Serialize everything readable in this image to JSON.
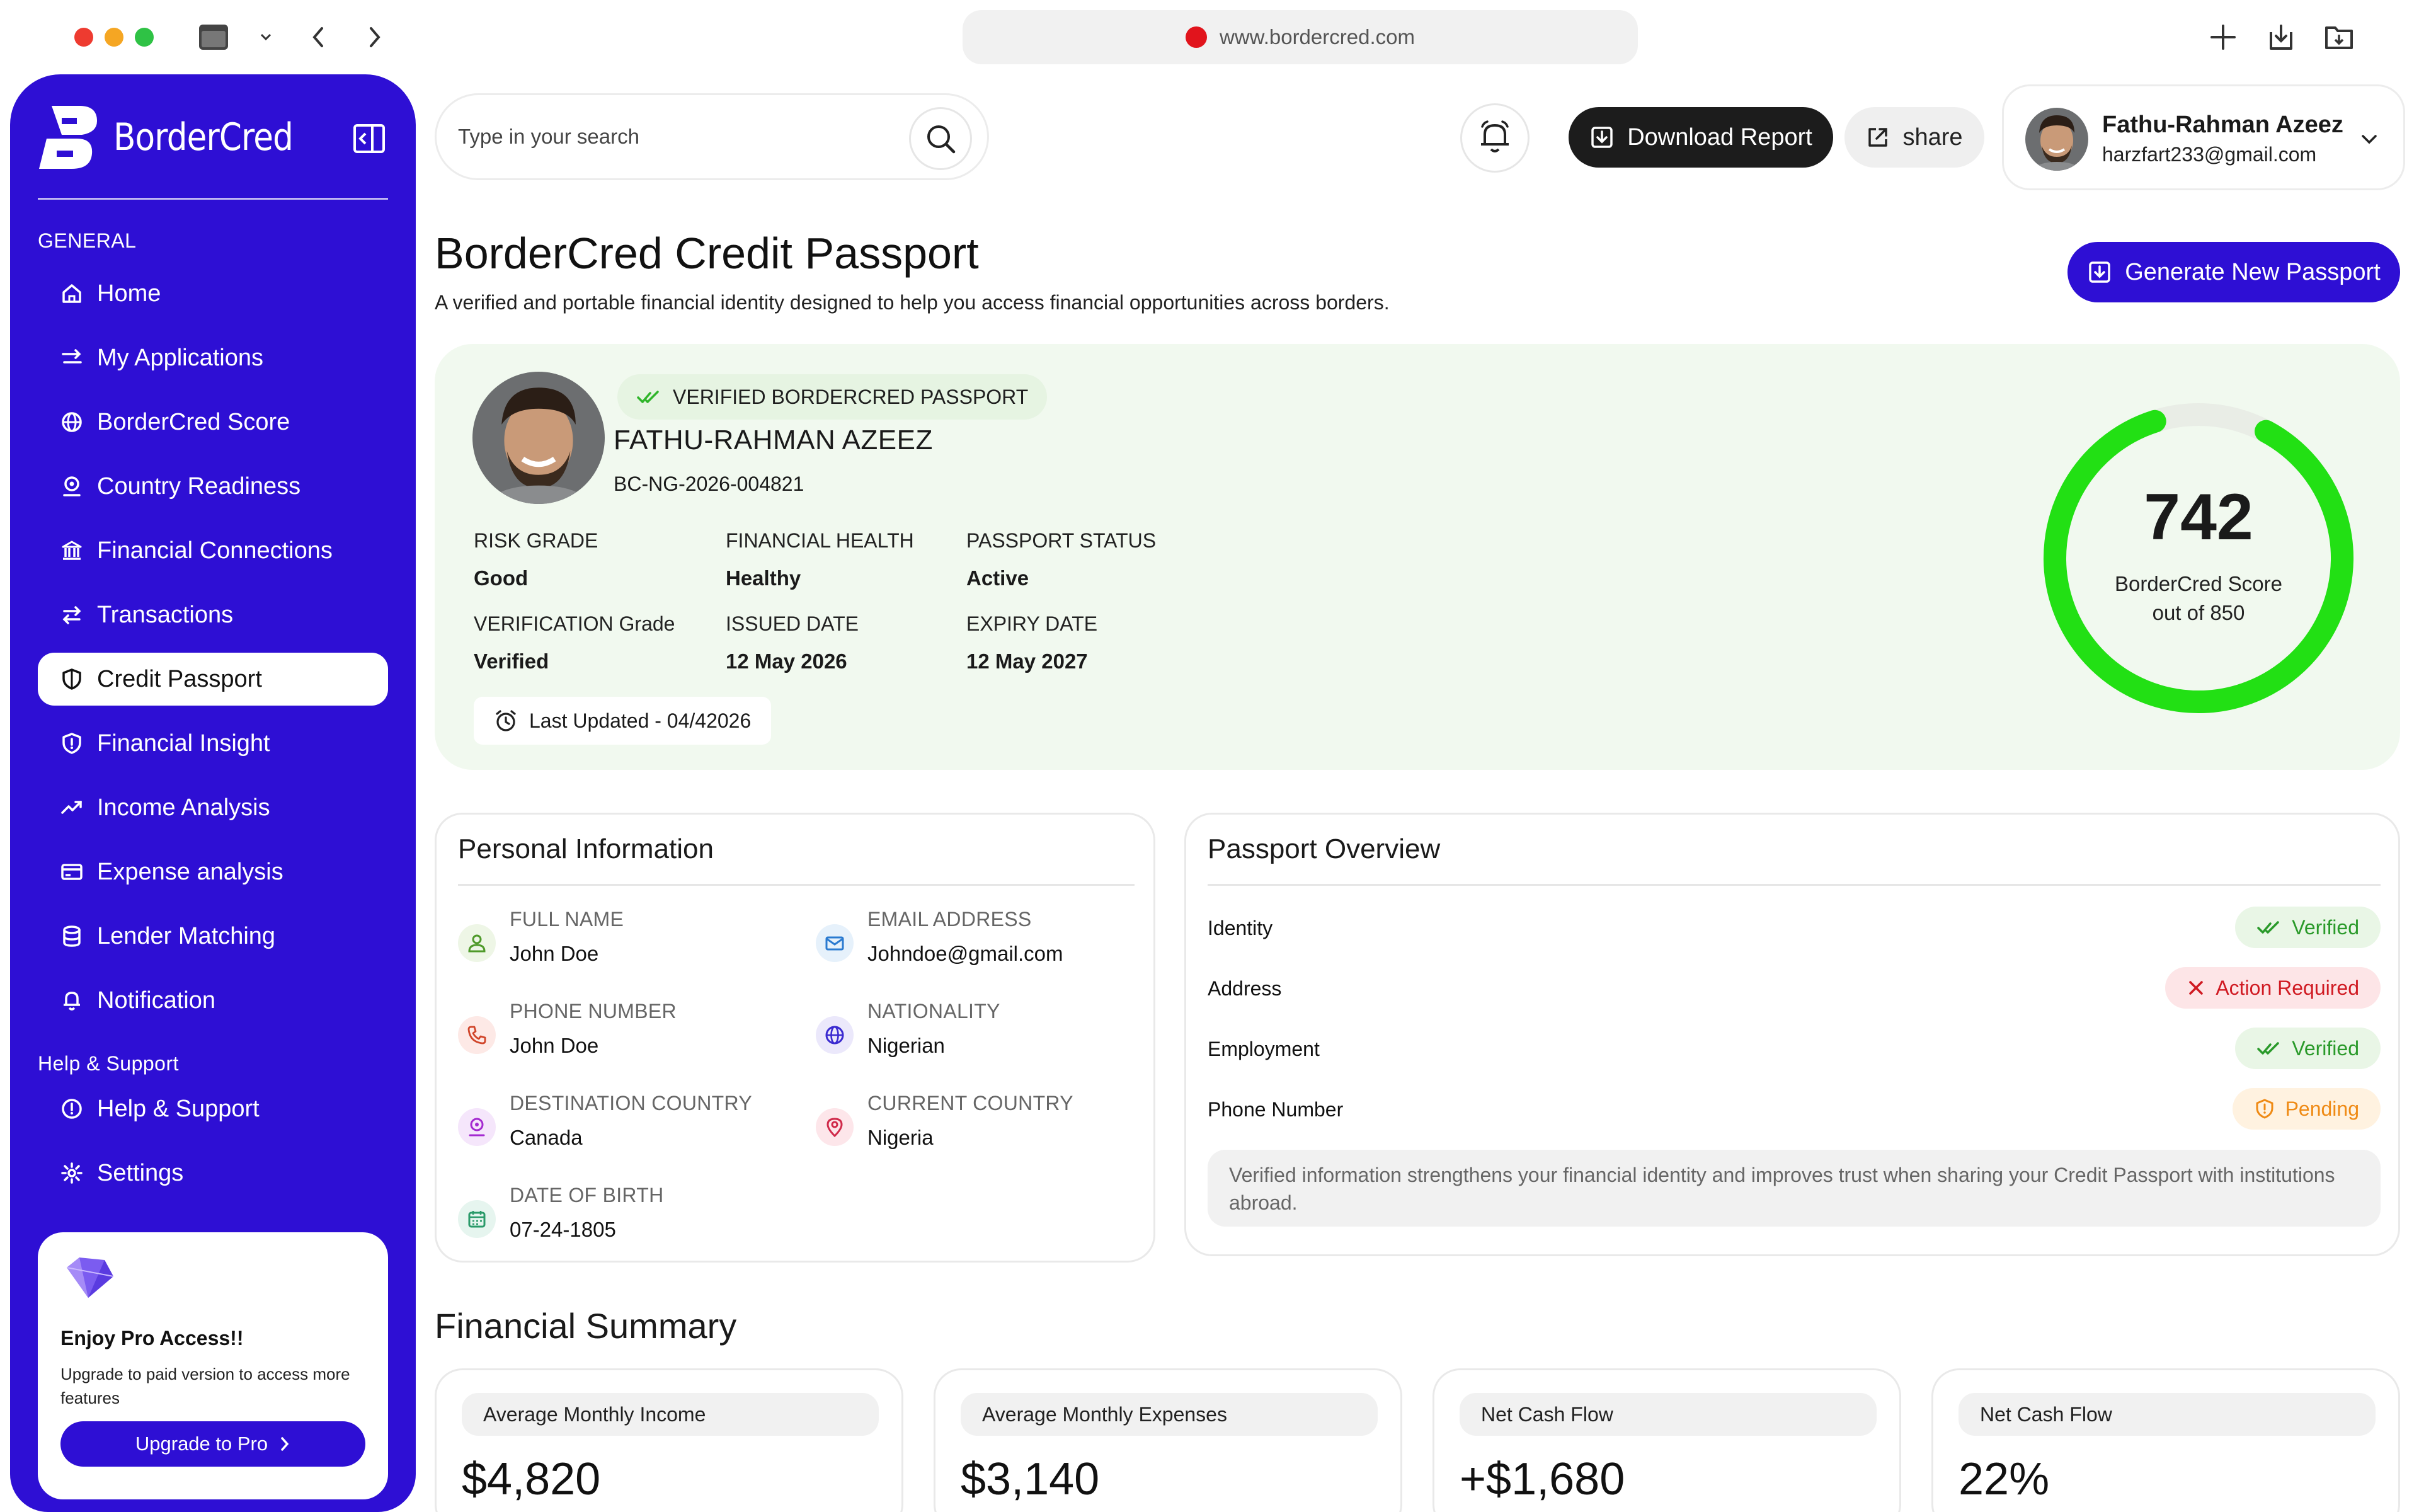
{
  "browser": {
    "url": "www.bordercred.com"
  },
  "brand": {
    "name": "BorderCred",
    "primary_color": "#2e0fd4",
    "accent_green": "#22e014"
  },
  "sidebar": {
    "general_title": "GENERAL",
    "items": [
      {
        "label": "Home",
        "icon": "home-icon"
      },
      {
        "label": "My Applications",
        "icon": "arrows-icon"
      },
      {
        "label": "BorderCred Score",
        "icon": "globe-icon"
      },
      {
        "label": "Country Readiness",
        "icon": "location-icon"
      },
      {
        "label": "Financial Connections",
        "icon": "bank-icon"
      },
      {
        "label": "Transactions",
        "icon": "transfer-icon"
      },
      {
        "label": "Credit Passport",
        "icon": "shield-icon"
      },
      {
        "label": "Financial Insight",
        "icon": "shield-icon"
      },
      {
        "label": "Income Analysis",
        "icon": "trend-icon"
      },
      {
        "label": "Expense analysis",
        "icon": "card-icon"
      },
      {
        "label": "Lender Matching",
        "icon": "database-icon"
      },
      {
        "label": "Notification",
        "icon": "bell-icon"
      }
    ],
    "support_title": "Help & Support",
    "support_items": [
      {
        "label": "Help & Support",
        "icon": "info-icon"
      },
      {
        "label": "Settings",
        "icon": "gear-icon"
      }
    ],
    "pro": {
      "title": "Enjoy Pro Access!!",
      "text": "Upgrade to paid version to access more features",
      "button": "Upgrade to Pro"
    }
  },
  "topbar": {
    "search_placeholder": "Type in your search",
    "download_label": "Download Report",
    "share_label": "share",
    "user_name": "Fathu-Rahman Azeez",
    "user_email": "harzfart233@gmail.com"
  },
  "header": {
    "title": "BorderCred Credit Passport",
    "subtitle": "A verified and portable financial identity designed to help you access financial opportunities across borders.",
    "generate_label": "Generate New Passport"
  },
  "passport": {
    "badge": "VERIFIED BORDERCRED PASSPORT",
    "name": "FATHU-RAHMAN AZEEZ",
    "id": "BC-NG-2026-004821",
    "fields": [
      {
        "label": "RISK GRADE",
        "value": "Good"
      },
      {
        "label": "FINANCIAL HEALTH",
        "value": "Healthy"
      },
      {
        "label": "PASSPORT STATUS",
        "value": "Active"
      },
      {
        "label": "VERIFICATION Grade",
        "value": "Verified"
      },
      {
        "label": "ISSUED DATE",
        "value": "12 May 2026"
      },
      {
        "label": "EXPIRY DATE",
        "value": "12 May 2027"
      }
    ],
    "last_updated": "Last Updated - 04/42026",
    "score": 742,
    "score_max": 850,
    "score_label": "BorderCred Score",
    "score_sub": "out of 850"
  },
  "personal_info": {
    "title": "Personal Information",
    "items": [
      {
        "label": "FULL NAME",
        "value": "John Doe",
        "icon": "user-icon",
        "bg": "#eef6e6",
        "fg": "#4f9a2a"
      },
      {
        "label": "EMAIL ADDRESS",
        "value": "Johndoe@gmail.com",
        "icon": "mail-icon",
        "bg": "#e6f1fb",
        "fg": "#2a7ad0"
      },
      {
        "label": "PHONE NUMBER",
        "value": "John Doe",
        "icon": "phone-icon",
        "bg": "#fde9e6",
        "fg": "#d0452a"
      },
      {
        "label": "NATIONALITY",
        "value": "Nigerian",
        "icon": "globe-icon",
        "bg": "#ebe8fb",
        "fg": "#3a2ad0"
      },
      {
        "label": "DESTINATION COUNTRY",
        "value": "Canada",
        "icon": "location-icon",
        "bg": "#f5e6fb",
        "fg": "#a42ad0"
      },
      {
        "label": "CURRENT COUNTRY",
        "value": "Nigeria",
        "icon": "pin-icon",
        "bg": "#fde6ea",
        "fg": "#d02a4a"
      },
      {
        "label": "DATE OF BIRTH",
        "value": "07-24-1805",
        "icon": "calendar-icon",
        "bg": "#e6f5ef",
        "fg": "#2a9a6a"
      }
    ]
  },
  "overview": {
    "title": "Passport Overview",
    "rows": [
      {
        "label": "Identity",
        "status": "Verified",
        "kind": "verified"
      },
      {
        "label": "Address",
        "status": "Action Required",
        "kind": "action"
      },
      {
        "label": "Employment",
        "status": "Verified",
        "kind": "verified"
      },
      {
        "label": "Phone Number",
        "status": "Pending",
        "kind": "pending"
      }
    ],
    "note": "Verified information strengthens your financial identity and improves trust when sharing your Credit Passport with institutions abroad."
  },
  "financial_summary": {
    "title": "Financial Summary",
    "cards": [
      {
        "label": "Average Monthly Income",
        "value": "$4,820"
      },
      {
        "label": "Average Monthly Expenses",
        "value": "$3,140"
      },
      {
        "label": "Net Cash Flow",
        "value": "+$1,680"
      },
      {
        "label": "Net Cash Flow",
        "value": "22%"
      }
    ]
  }
}
